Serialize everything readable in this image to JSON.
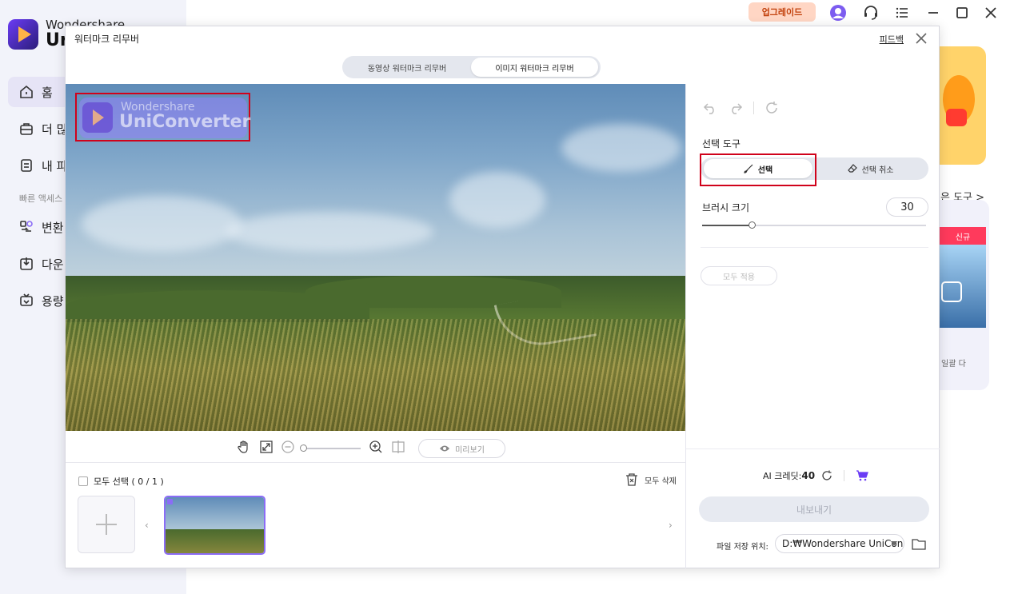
{
  "app": {
    "brand_top": "Wondershare",
    "brand_main": "Ur",
    "nav": [
      {
        "label": "홈",
        "icon": "home-icon"
      },
      {
        "label": "더 많",
        "icon": "toolbox-icon"
      },
      {
        "label": "내 파",
        "icon": "file-icon"
      }
    ],
    "quick_access": "빠른 액세스",
    "quick_items": [
      {
        "label": "변환",
        "icon": "convert-icon"
      },
      {
        "label": "다운",
        "icon": "download-icon"
      },
      {
        "label": "용량",
        "icon": "compress-icon"
      }
    ],
    "upgrade": "업그레이드",
    "tools_link": "은 도구 >",
    "new_badge": "신규",
    "new_text": "일괄 다",
    "colors": {
      "accent": "#8b6cf6",
      "highlight": "#d0021b",
      "upgrade_bg": "#ffd6c4"
    }
  },
  "modal": {
    "title": "워터마크 리무버",
    "feedback": "피드백",
    "tabs": [
      {
        "label": "동영상 워터마크 리무버"
      },
      {
        "label": "이미지 워터마크 리무버"
      }
    ],
    "watermark": {
      "top": "Wondershare",
      "main": "UniConverter"
    },
    "preview": "미리보기",
    "select_all": "모두 선택 ( 0 / 1 )",
    "delete_all": "모두 삭제"
  },
  "panel": {
    "selection_tool": "선택 도구",
    "select": "선택",
    "deselect": "선택 취소",
    "brush_size_label": "브러시 크기",
    "brush_size": "30",
    "brush_level": 0.22,
    "apply_all": "모두 적용",
    "credits_label": "AI 크레딧:",
    "credits_value": "40",
    "export": "내보내기",
    "save_label": "파일 저장 위치:",
    "save_path": "D:₩Wondershare UniConverter"
  }
}
